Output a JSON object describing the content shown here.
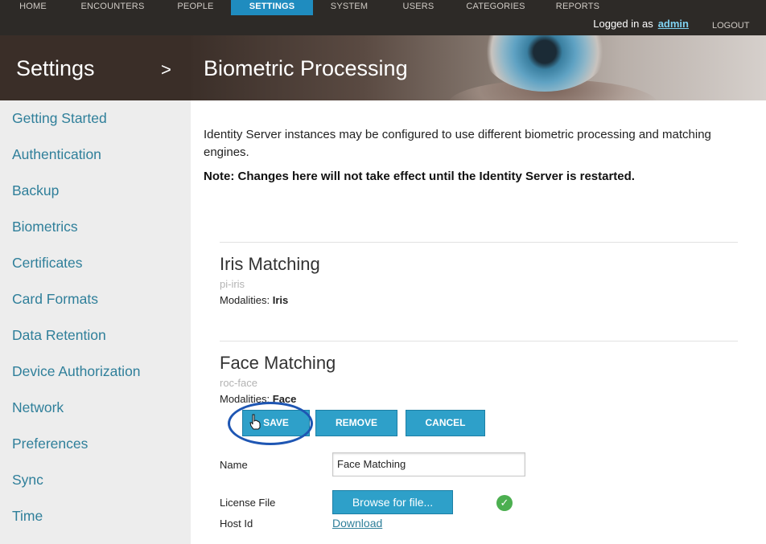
{
  "nav": {
    "items": [
      {
        "label": "HOME",
        "active": false
      },
      {
        "label": "ENCOUNTERS",
        "active": false
      },
      {
        "label": "PEOPLE",
        "active": false
      },
      {
        "label": "SETTINGS",
        "active": true
      },
      {
        "label": "SYSTEM",
        "active": false
      },
      {
        "label": "USERS",
        "active": false
      },
      {
        "label": "CATEGORIES",
        "active": false
      },
      {
        "label": "REPORTS",
        "active": false
      }
    ],
    "logged_in_prefix": "Logged in as",
    "username": "admin",
    "logout_label": "LOGOUT"
  },
  "banner": {
    "section": "Settings",
    "separator": ">",
    "page_title": "Biometric Processing"
  },
  "sidebar": {
    "items": [
      {
        "label": "Getting Started"
      },
      {
        "label": "Authentication"
      },
      {
        "label": "Backup"
      },
      {
        "label": "Biometrics"
      },
      {
        "label": "Certificates"
      },
      {
        "label": "Card Formats"
      },
      {
        "label": "Data Retention"
      },
      {
        "label": "Device Authorization"
      },
      {
        "label": "Network"
      },
      {
        "label": "Preferences"
      },
      {
        "label": "Sync"
      },
      {
        "label": "Time"
      }
    ]
  },
  "main": {
    "intro": "Identity Server instances may be configured to use different biometric processing and matching engines.",
    "note": "Note: Changes here will not take effect until the Identity Server is restarted.",
    "engines": [
      {
        "title": "Iris Matching",
        "id": "pi-iris",
        "modalities_label": "Modalities:",
        "modalities_value": "Iris"
      },
      {
        "title": "Face Matching",
        "id": "roc-face",
        "modalities_label": "Modalities:",
        "modalities_value": "Face"
      }
    ],
    "buttons": {
      "save": "SAVE",
      "remove": "REMOVE",
      "cancel": "CANCEL"
    },
    "form": {
      "name_label": "Name",
      "name_value": "Face Matching",
      "license_label": "License File",
      "browse_label": "Browse for file...",
      "license_status_icon": "check-circle",
      "host_id_label": "Host Id",
      "download_label": "Download"
    }
  },
  "colors": {
    "nav_bg": "#2d2a27",
    "nav_active": "#1f8cbf",
    "button_bg": "#2ea0c9",
    "link": "#2f7f9a",
    "sidebar_bg": "#ededed",
    "success": "#4caf50",
    "highlight_ring": "#1e56b3"
  }
}
